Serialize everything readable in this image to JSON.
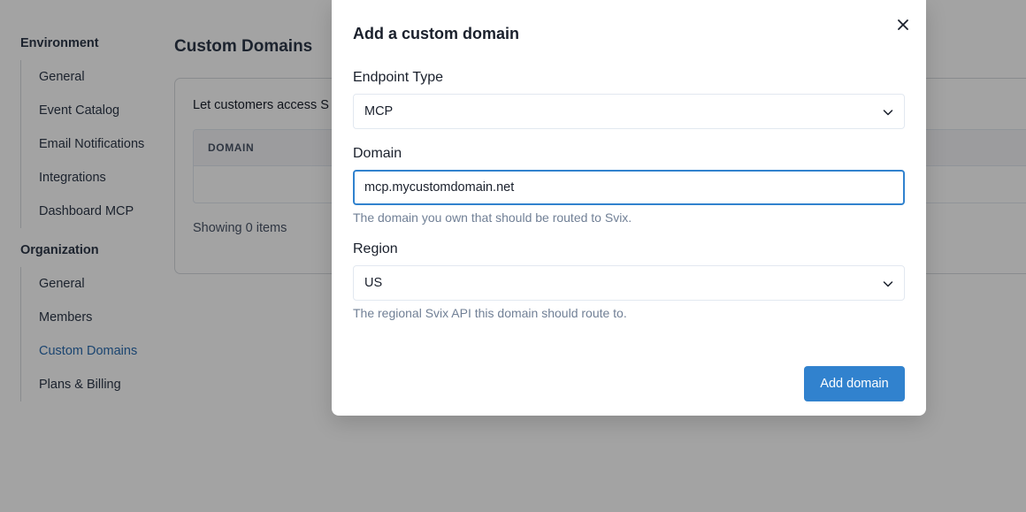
{
  "sidebar": {
    "environment": {
      "title": "Environment",
      "items": [
        {
          "label": "General"
        },
        {
          "label": "Event Catalog"
        },
        {
          "label": "Email Notifications"
        },
        {
          "label": "Integrations"
        },
        {
          "label": "Dashboard MCP"
        }
      ]
    },
    "organization": {
      "title": "Organization",
      "items": [
        {
          "label": "General"
        },
        {
          "label": "Members"
        },
        {
          "label": "Custom Domains",
          "active": true
        },
        {
          "label": "Plans & Billing"
        }
      ]
    }
  },
  "main": {
    "title": "Custom Domains",
    "description": "Let customers access S",
    "table": {
      "columns": [
        "DOMAIN"
      ]
    },
    "showing": "Showing 0 items"
  },
  "modal": {
    "title": "Add a custom domain",
    "close_icon": "close-icon",
    "endpoint_type": {
      "label": "Endpoint Type",
      "value": "MCP"
    },
    "domain": {
      "label": "Domain",
      "value": "mcp.mycustomdomain.net",
      "helper": "The domain you own that should be routed to Svix."
    },
    "region": {
      "label": "Region",
      "value": "US",
      "helper": "The regional Svix API this domain should route to."
    },
    "submit_label": "Add domain"
  },
  "colors": {
    "accent": "#3182ce",
    "active_link": "#2b6cb0"
  }
}
